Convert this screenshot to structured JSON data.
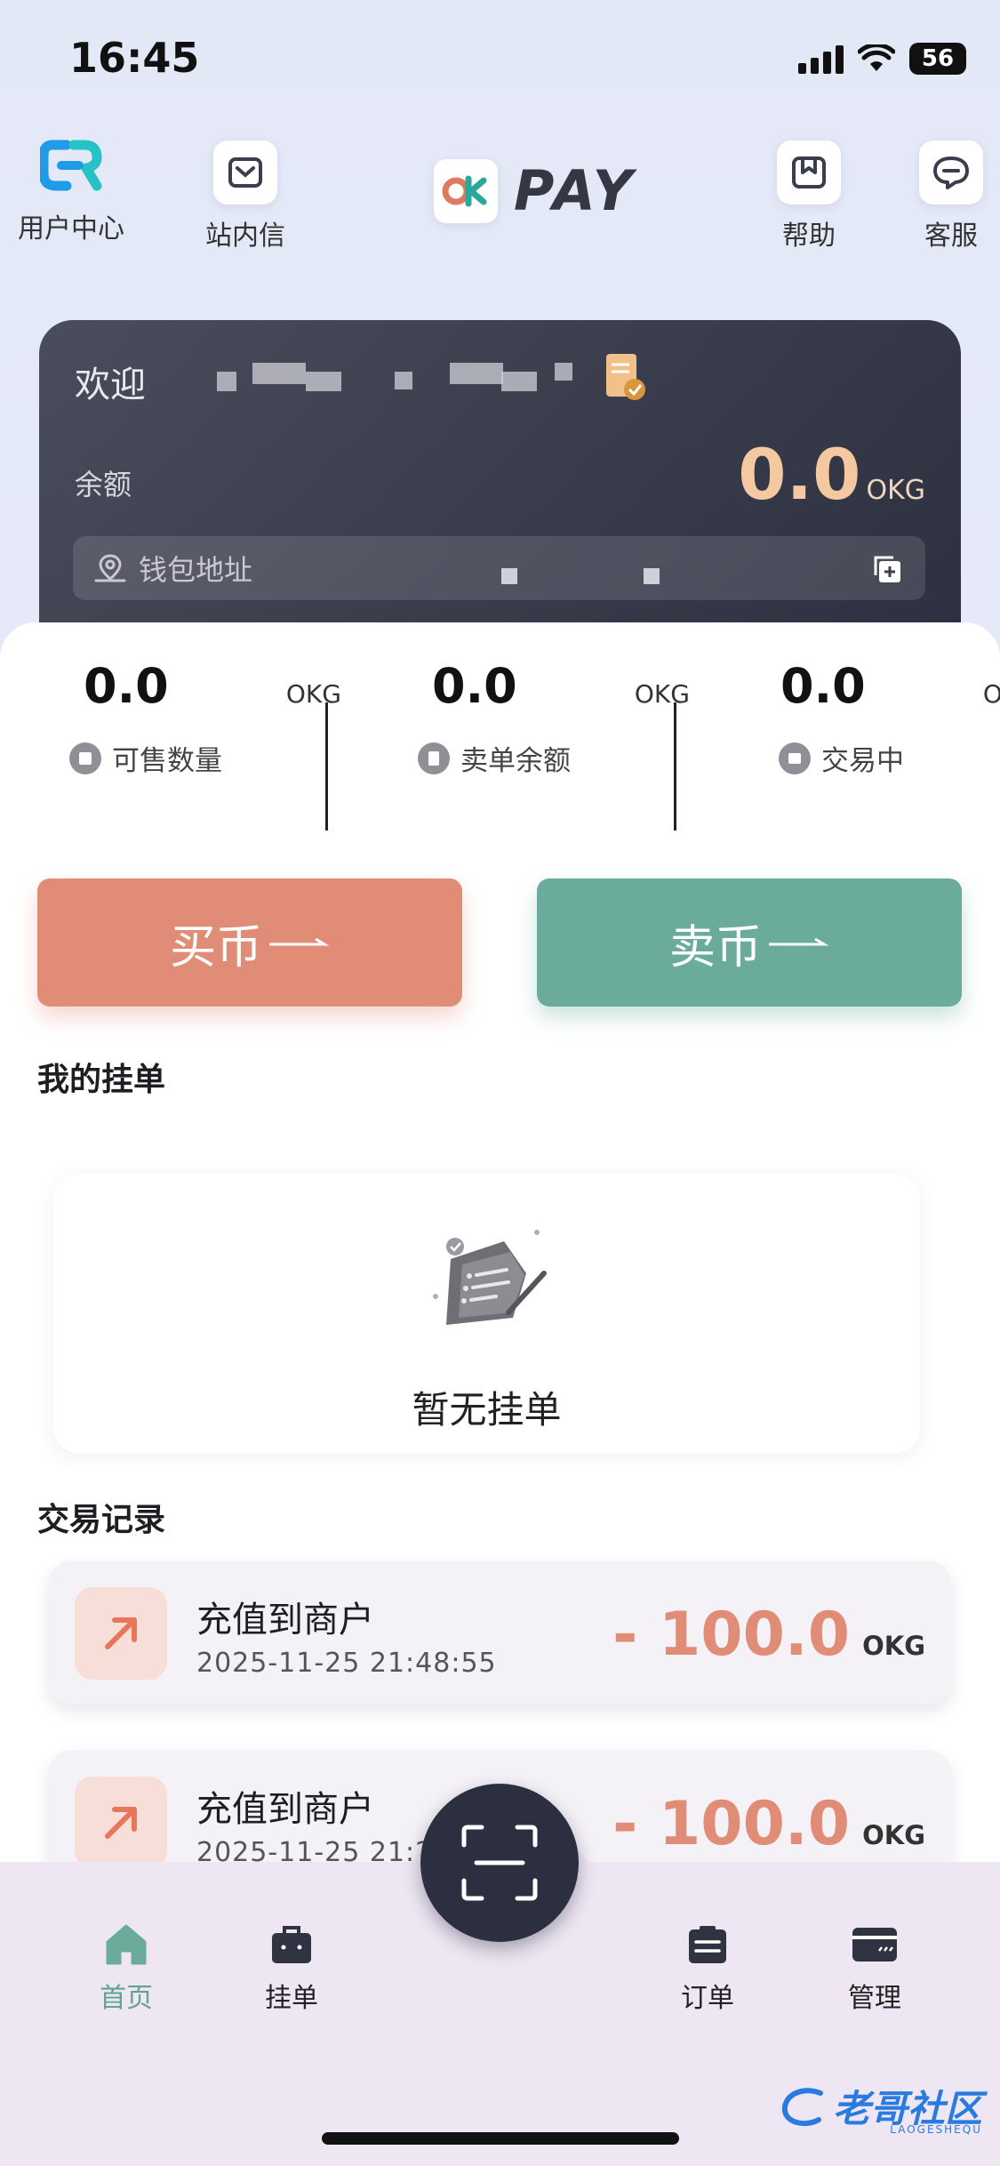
{
  "status_bar": {
    "time": "16:45",
    "battery": "56"
  },
  "top_nav": {
    "user_center": "用户中心",
    "messages": "站内信",
    "help": "帮助",
    "support": "客服",
    "logo_text": "PAY"
  },
  "wallet": {
    "welcome": "欢迎",
    "balance_label": "余额",
    "balance_value": "0.0",
    "balance_unit": "OKG",
    "address_placeholder": "钱包地址"
  },
  "stats": [
    {
      "value": "0.0",
      "unit": "OKG",
      "label": "可售数量"
    },
    {
      "value": "0.0",
      "unit": "OKG",
      "label": "卖单余额"
    },
    {
      "value": "0.0",
      "unit": "OKG",
      "label": "交易中"
    }
  ],
  "actions": {
    "buy": "买币",
    "sell": "卖币"
  },
  "my_orders": {
    "title": "我的挂单",
    "empty_text": "暂无挂单"
  },
  "transactions": {
    "title": "交易记录",
    "items": [
      {
        "title": "充值到商户",
        "time": "2025-11-25 21:48:55",
        "amount": "- 100.0",
        "unit": "OKG"
      },
      {
        "title": "充值到商户",
        "time": "2025-11-25 21:26",
        "amount": "- 100.0",
        "unit": "OKG"
      }
    ]
  },
  "tabs": {
    "home": "首页",
    "listings": "挂单",
    "orders": "订单",
    "manage": "管理"
  },
  "colors": {
    "buy": "#e08c76",
    "sell": "#6aab9c",
    "active_tab": "#5fa396",
    "card_dark": "#3b3e4d"
  },
  "watermark": {
    "text": "老哥社区",
    "sub": "LAOGESHEQU"
  }
}
